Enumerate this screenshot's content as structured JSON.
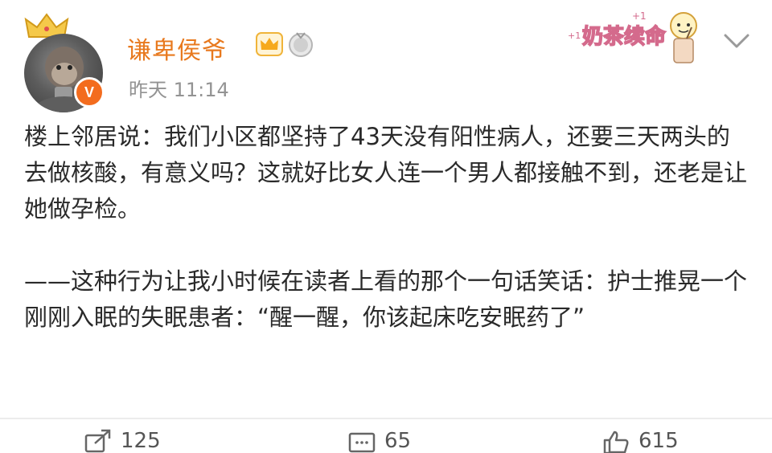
{
  "post": {
    "username": "谦卑侯爷",
    "time": "昨天 11:14",
    "verified_mark": "V",
    "body": "楼上邻居说：我们小区都坚持了43天没有阳性病人，还要三天两头的去做核酸，有意义吗？这就好比女人连一个男人都接触不到，还老是让她做孕检。\n\n——这种行为让我小时候在读者上看的那个一句话笑话：护士推晃一个刚刚入眠的失眠患者：“醒一醒，你该起床吃安眠药了”"
  },
  "decorations": {
    "sticker_text": "奶茶续命",
    "sticker_plus": "+1"
  },
  "footer": {
    "repost_count": "125",
    "comment_count": "65",
    "like_count": "615"
  },
  "icons": [
    "crown-icon",
    "medal-icon",
    "chevron-down-icon",
    "repost-icon",
    "comment-icon",
    "like-icon"
  ],
  "colors": {
    "username": "#e8791e",
    "verified": "#f36c1e",
    "time": "#939393"
  }
}
